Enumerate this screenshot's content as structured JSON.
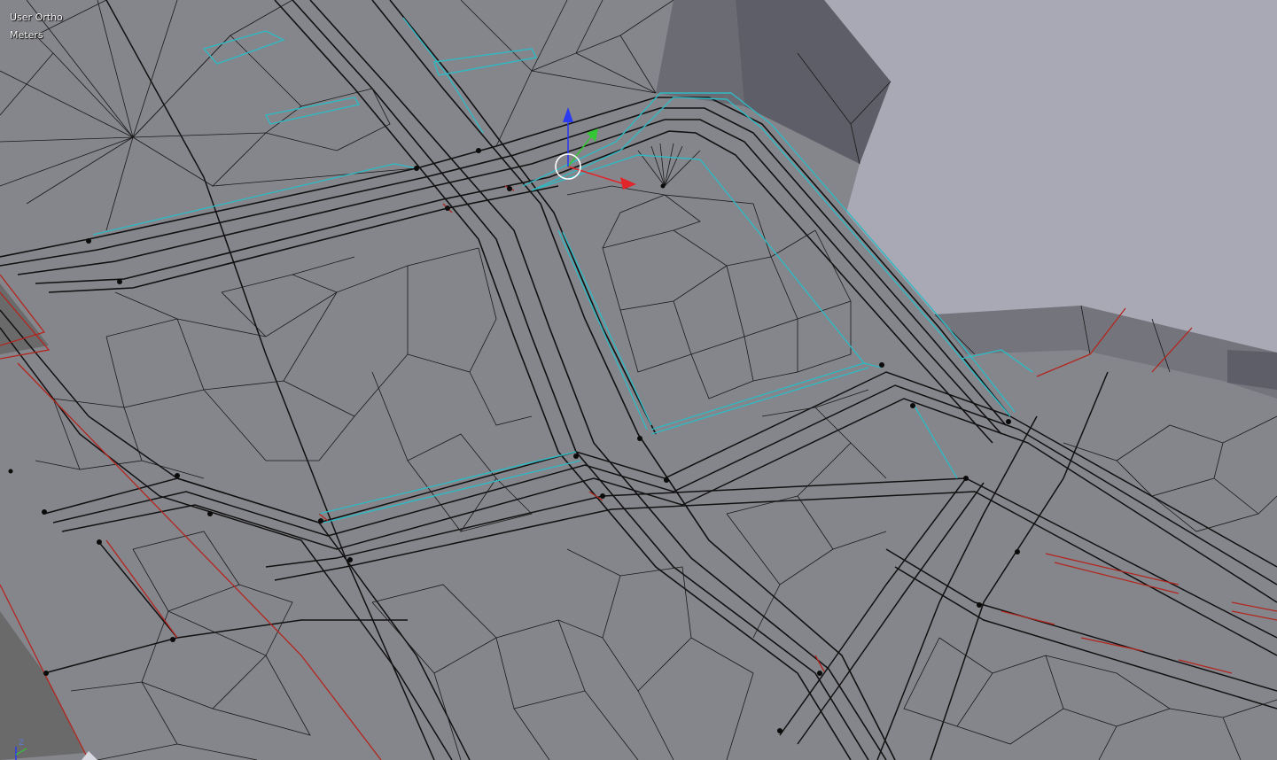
{
  "viewport": {
    "view_label": "User Ortho",
    "units_label": "Meters",
    "colors": {
      "background": "#a9a9b6",
      "mesh_face": "#85858c",
      "mesh_face_light": "#8f8f96",
      "mesh_face_dark": "#5c5c66",
      "edge": "#111111",
      "selected_edge": "#2fb9c2",
      "seam_edge": "#b3261e"
    }
  },
  "gizmo": {
    "x_color": "#e0262a",
    "y_color": "#35c635",
    "z_color": "#2b3cf0"
  },
  "axis_indicator": {
    "z_label": "Z"
  }
}
